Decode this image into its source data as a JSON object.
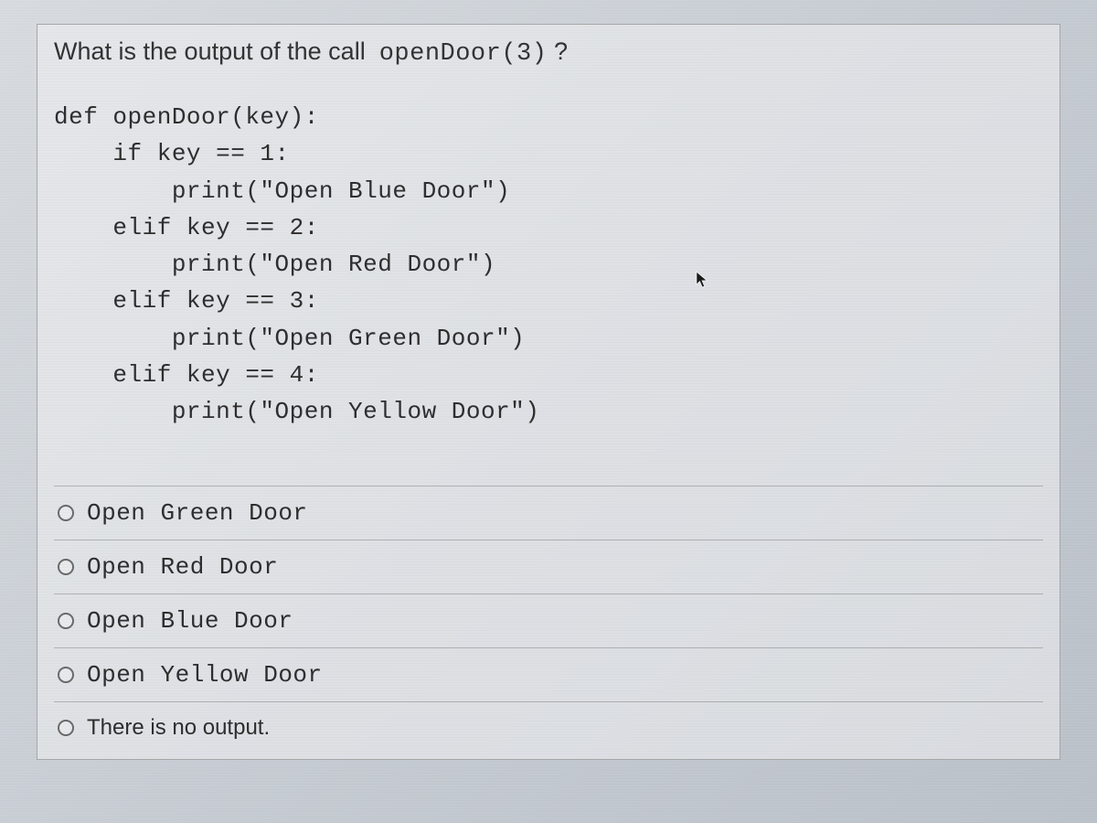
{
  "question": {
    "prefix": "What is the output of the call",
    "code_inline": "openDoor(3)",
    "suffix": "?"
  },
  "code": {
    "line1": "def openDoor(key):",
    "line2": "    if key == 1:",
    "line3": "        print(\"Open Blue Door\")",
    "line4": "    elif key == 2:",
    "line5": "        print(\"Open Red Door\")",
    "line6": "    elif key == 3:",
    "line7": "        print(\"Open Green Door\")",
    "line8": "    elif key == 4:",
    "line9": "        print(\"Open Yellow Door\")"
  },
  "options": {
    "a": "Open Green Door",
    "b": "Open Red Door",
    "c": "Open Blue Door",
    "d": "Open Yellow Door",
    "e": "There is no output."
  }
}
